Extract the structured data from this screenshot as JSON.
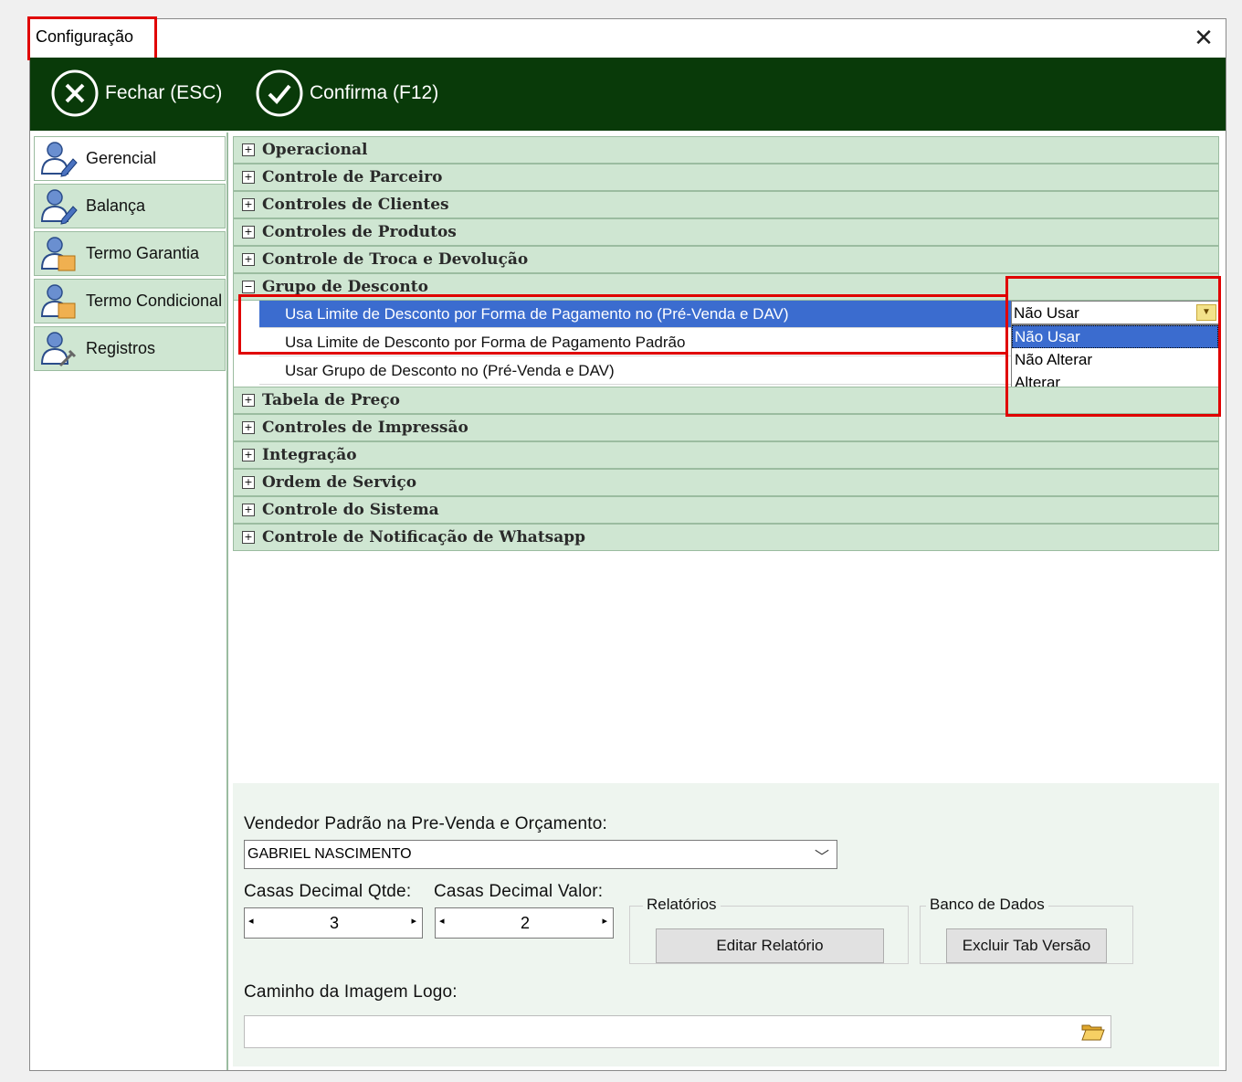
{
  "window": {
    "title": "Configuração",
    "close_symbol": "✕"
  },
  "toolbar": {
    "close_label": "Fechar (ESC)",
    "confirm_label": "Confirma (F12)"
  },
  "sidebar": {
    "items": [
      {
        "label": "Gerencial",
        "icon": "user-edit-icon",
        "active": true
      },
      {
        "label": "Balança",
        "icon": "user-edit-icon",
        "active": false
      },
      {
        "label": "Termo Garantia",
        "icon": "user-document-icon",
        "active": false
      },
      {
        "label": "Termo Condicional",
        "icon": "user-document-icon",
        "active": false
      },
      {
        "label": "Registros",
        "icon": "user-tools-icon",
        "active": false
      }
    ]
  },
  "tree": {
    "categories": [
      {
        "label": "Operacional",
        "expanded": false
      },
      {
        "label": "Controle de Parceiro",
        "expanded": false
      },
      {
        "label": "Controles de Clientes",
        "expanded": false
      },
      {
        "label": "Controles de Produtos",
        "expanded": false
      },
      {
        "label": "Controle de Troca e Devolução",
        "expanded": false
      },
      {
        "label": "Grupo de Desconto",
        "expanded": true
      },
      {
        "label": "Tabela de Preço",
        "expanded": false
      },
      {
        "label": "Controles de Impressão",
        "expanded": false
      },
      {
        "label": "Integração",
        "expanded": false
      },
      {
        "label": "Ordem de Serviço",
        "expanded": false
      },
      {
        "label": "Controle do Sistema",
        "expanded": false
      },
      {
        "label": "Controle de Notificação de Whatsapp",
        "expanded": false
      }
    ],
    "expanded_symbol": "−",
    "collapsed_symbol": "+",
    "group_rows": [
      {
        "label": "Usa Limite de Desconto por Forma de Pagamento no  (Pré-Venda e DAV)",
        "selected": true
      },
      {
        "label": "Usa Limite de Desconto por Forma de Pagamento Padrão",
        "selected": false
      },
      {
        "label": "Usar Grupo de Desconto no  (Pré-Venda e DAV)",
        "selected": false
      }
    ],
    "dropdown": {
      "value": "Não Usar",
      "options": [
        "Não Usar",
        "Não Alterar",
        "Alterar"
      ],
      "selected_index": 0
    }
  },
  "bottom": {
    "vendedor_label": "Vendedor Padrão na Pre-Venda e Orçamento:",
    "vendedor_value": "GABRIEL NASCIMENTO",
    "casas_qtde_label": "Casas Decimal Qtde:",
    "casas_qtde_value": "3",
    "casas_valor_label": "Casas Decimal Valor:",
    "casas_valor_value": "2",
    "relatorios_group": "Relatórios",
    "editar_relatorio": "Editar Relatório",
    "banco_group": "Banco de Dados",
    "excluir_tab": "Excluir Tab Versão",
    "logo_label": "Caminho da Imagem Logo:",
    "logo_value": ""
  },
  "colors": {
    "toolbar_bg": "#093a09",
    "category_bg": "#cfe6d2",
    "selection": "#3b6ccf",
    "highlight": "#e00000"
  }
}
